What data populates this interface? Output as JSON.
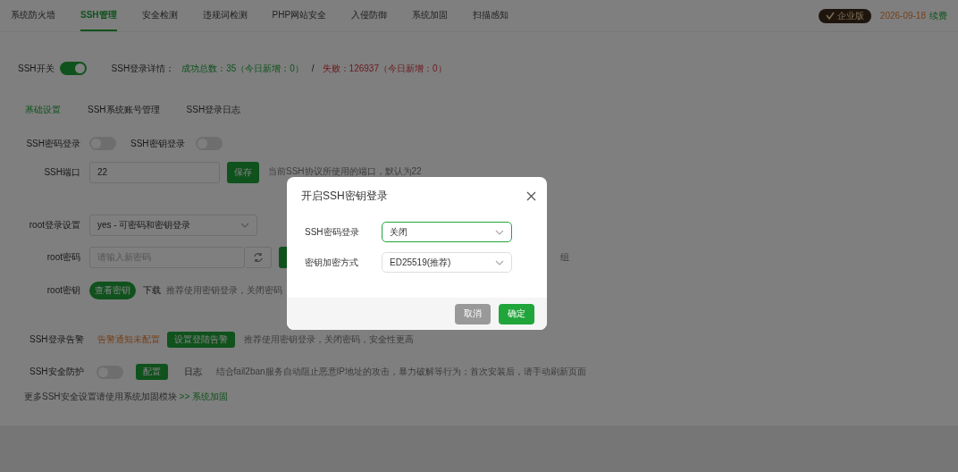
{
  "nav": {
    "tabs": [
      {
        "label": "系统防火墙",
        "selected": false
      },
      {
        "label": "SSH管理",
        "selected": true
      },
      {
        "label": "安全检测",
        "selected": false
      },
      {
        "label": "违规词检测",
        "selected": false
      },
      {
        "label": "PHP网站安全",
        "selected": false
      },
      {
        "label": "入侵防御",
        "selected": false
      },
      {
        "label": "系统加固",
        "selected": false
      },
      {
        "label": "扫描感知",
        "selected": false
      }
    ],
    "edition_badge": "企业版",
    "expiry": "2026-09-18",
    "renew_link": "续费"
  },
  "ssh_switch": {
    "label": "SSH开关",
    "on": true
  },
  "login_details": {
    "label": "SSH登录详情：",
    "success": "成功总数：35（今日新增：0）",
    "separator": "/",
    "failure": "失败：126937（今日新增：0）"
  },
  "sub_tabs": [
    {
      "label": "基础设置",
      "selected": true
    },
    {
      "label": "SSH系统账号管理",
      "selected": false
    },
    {
      "label": "SSH登录日志",
      "selected": false
    }
  ],
  "password_login": {
    "label": "SSH密码登录",
    "on": false
  },
  "key_login": {
    "label": "SSH密钥登录",
    "on": false
  },
  "port": {
    "label": "SSH端口",
    "value": "22",
    "button": "保存",
    "hint": "当前SSH协议所使用的端口，默认为22"
  },
  "root_login": {
    "label": "root登录设置",
    "value": "yes - 可密码和密钥登录"
  },
  "root_password": {
    "label": "root密码",
    "placeholder": "请输入新密码",
    "trailing_text": "组"
  },
  "root_key": {
    "label": "root密钥",
    "button": "查看密钥",
    "link": "下载",
    "hint": "推荐使用密钥登录，关闭密码"
  },
  "login_alert": {
    "label": "SSH登录告警",
    "status": "告警通知未配置",
    "button": "设置登陆告警",
    "hint": "推荐使用密钥登录，关闭密码，安全性更高"
  },
  "protection": {
    "label": "SSH安全防护",
    "on": false,
    "button": "配置",
    "link": "日志",
    "hint": "结合fail2ban服务自动阻止恶意IP地址的攻击，暴力破解等行为；首次安装后，请手动刷新页面"
  },
  "footer_note": {
    "text": "更多SSH安全设置请使用系统加固模块",
    "link": ">> 系统加固"
  },
  "dialog": {
    "title": "开启SSH密钥登录",
    "fields": [
      {
        "label": "SSH密码登录",
        "value": "关闭",
        "focused": true
      },
      {
        "label": "密钥加密方式",
        "value": "ED25519(推荐)",
        "focused": false
      }
    ],
    "cancel": "取消",
    "confirm": "确定"
  }
}
